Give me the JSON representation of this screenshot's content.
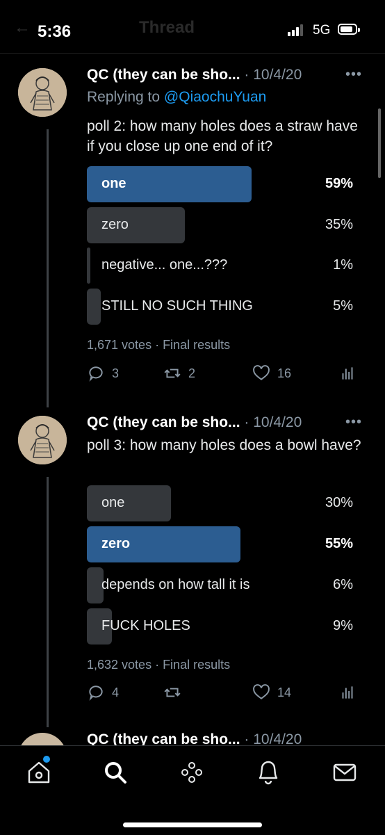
{
  "status": {
    "time": "5:36",
    "network": "5G",
    "back_ghost": "←",
    "title_ghost": "Thread"
  },
  "tweets": [
    {
      "name": "QC (they can be sho...",
      "meta": "· 10/4/20",
      "replying_prefix": "Replying to ",
      "replying_handle": "@QiaochuYuan",
      "text": "poll 2: how many holes does a straw have if you close up one end of it?",
      "poll": [
        {
          "label": "one",
          "pct": "59%",
          "value": 59,
          "winner": true
        },
        {
          "label": "zero",
          "pct": "35%",
          "value": 35,
          "winner": false
        },
        {
          "label": "negative... one...???",
          "pct": "1%",
          "value": 1,
          "winner": false
        },
        {
          "label": "STILL NO SUCH THING",
          "pct": "5%",
          "value": 5,
          "winner": false
        }
      ],
      "votes": "1,671 votes · Final results",
      "replies": "3",
      "retweets": "2",
      "likes": "16"
    },
    {
      "name": "QC (they can be sho...",
      "meta": "· 10/4/20",
      "text": "poll 3: how many holes does a bowl have?",
      "poll": [
        {
          "label": "one",
          "pct": "30%",
          "value": 30,
          "winner": false
        },
        {
          "label": "zero",
          "pct": "55%",
          "value": 55,
          "winner": true
        },
        {
          "label": "depends on how tall it is",
          "pct": "6%",
          "value": 6,
          "winner": false
        },
        {
          "label": "FUCK HOLES",
          "pct": "9%",
          "value": 9,
          "winner": false
        }
      ],
      "votes": "1,632 votes · Final results",
      "replies": "4",
      "retweets": "",
      "likes": "14"
    },
    {
      "name": "QC (they can be sho...",
      "meta": "· 10/4/20"
    }
  ],
  "colors": {
    "winner_bar": "#2c5d91",
    "other_bar": "#34373b",
    "link": "#1d9bf0",
    "muted": "#8b98a5"
  },
  "icons": {
    "more": "more-icon",
    "reply": "reply-icon",
    "retweet": "retweet-icon",
    "like": "like-icon",
    "analytics": "analytics-icon",
    "home": "home-icon",
    "search": "search-icon",
    "spaces": "spaces-icon",
    "notifications": "bell-icon",
    "messages": "mail-icon"
  }
}
